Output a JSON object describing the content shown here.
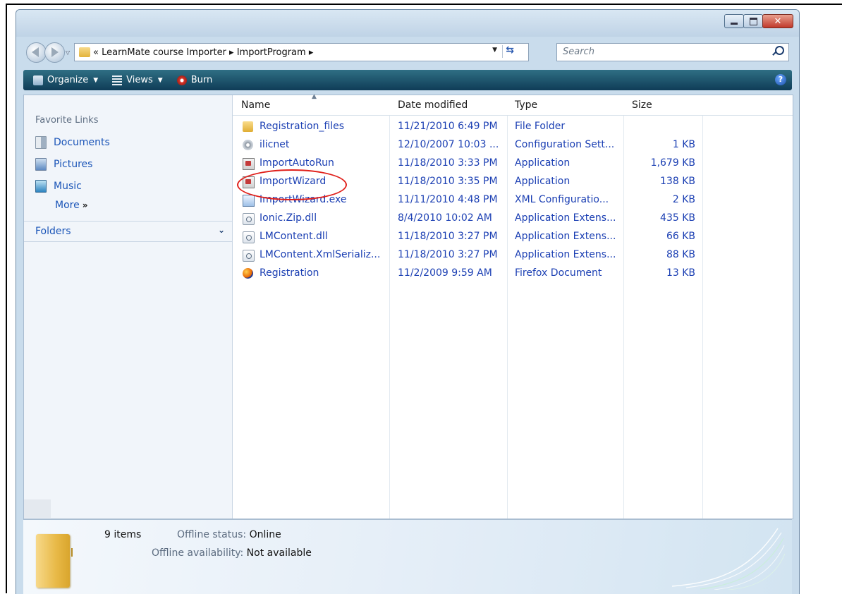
{
  "window": {
    "title_buttons": [
      "minimize",
      "maximize",
      "close"
    ]
  },
  "address": {
    "breadcrumb": "« LearnMate course Importer ▸ ImportProgram ▸",
    "search_placeholder": "Search"
  },
  "toolbar": {
    "organize": "Organize",
    "views": "Views",
    "burn": "Burn",
    "help": "?"
  },
  "sidebar": {
    "header": "Favorite Links",
    "items": [
      {
        "label": "Documents",
        "icon": "documents-icon"
      },
      {
        "label": "Pictures",
        "icon": "pictures-icon"
      },
      {
        "label": "Music",
        "icon": "music-icon"
      }
    ],
    "more": "More",
    "more_arrow": "»",
    "folders": "Folders"
  },
  "columns": {
    "name": "Name",
    "date": "Date modified",
    "type": "Type",
    "size": "Size"
  },
  "files": [
    {
      "name": "Registration_files",
      "date": "11/21/2010 6:49 PM",
      "type": "File Folder",
      "size": "",
      "icon": "folder-icon"
    },
    {
      "name": "ilicnet",
      "date": "12/10/2007 10:03 ...",
      "type": "Configuration Sett...",
      "size": "1 KB",
      "icon": "config-icon"
    },
    {
      "name": "ImportAutoRun",
      "date": "11/18/2010 3:33 PM",
      "type": "Application",
      "size": "1,679 KB",
      "icon": "application-icon"
    },
    {
      "name": "ImportWizard",
      "date": "11/18/2010 3:35 PM",
      "type": "Application",
      "size": "138 KB",
      "icon": "application-icon"
    },
    {
      "name": "ImportWizard.exe",
      "date": "11/11/2010 4:48 PM",
      "type": "XML Configuratio...",
      "size": "2 KB",
      "icon": "xml-icon"
    },
    {
      "name": "Ionic.Zip.dll",
      "date": "8/4/2010 10:02 AM",
      "type": "Application Extens...",
      "size": "435 KB",
      "icon": "dll-icon"
    },
    {
      "name": "LMContent.dll",
      "date": "11/18/2010 3:27 PM",
      "type": "Application Extens...",
      "size": "66 KB",
      "icon": "dll-icon"
    },
    {
      "name": "LMContent.XmlSerializ...",
      "date": "11/18/2010 3:27 PM",
      "type": "Application Extens...",
      "size": "88 KB",
      "icon": "dll-icon"
    },
    {
      "name": "Registration",
      "date": "11/2/2009 9:59 AM",
      "type": "Firefox Document",
      "size": "13 KB",
      "icon": "firefox-icon"
    }
  ],
  "details": {
    "count": "9 items",
    "offline_status_label": "Offline status:",
    "offline_status_value": "Online",
    "offline_availability_label": "Offline availability:",
    "offline_availability_value": "Not available"
  },
  "colors": {
    "link": "#1b3fb3",
    "toolbar": "#0f3c57",
    "highlight_circle": "#e0201b"
  }
}
